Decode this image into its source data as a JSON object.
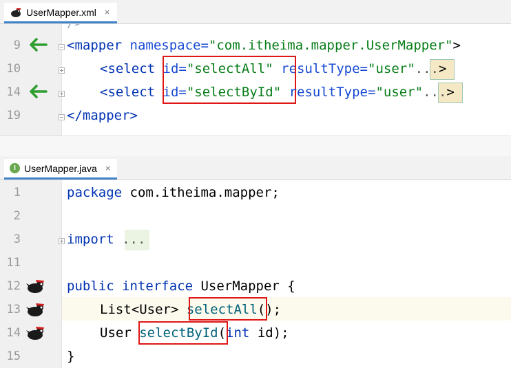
{
  "top_tab": {
    "label": "UserMapper.xml",
    "close": "×"
  },
  "bottom_tab": {
    "label": "UserMapper.java",
    "close": "×",
    "type_letter": "I"
  },
  "xml": {
    "line_numbers": [
      "9",
      "10",
      "14",
      "19"
    ],
    "mapper_open": "<mapper",
    "ns_attr": "namespace=",
    "ns_value": "\"com.itheima.mapper.UserMapper\"",
    "mapper_gt": ">",
    "select_open": "<select",
    "id1_attr": "id=",
    "id1_value": "\"selectAll\"",
    "rt_attr": "resultType=",
    "rt_value": "\"user\"",
    "folded": "...",
    "tag_end": ">",
    "id2_attr": "id=",
    "id2_value": "\"selectById\"",
    "mapper_close": "</mapper>",
    "partial_top": "/>"
  },
  "java": {
    "line_numbers": [
      "1",
      "2",
      "3",
      "11",
      "12",
      "13",
      "14",
      "15"
    ],
    "package_kw": "package",
    "package_name": " com.itheima.mapper;",
    "import_kw": "import",
    "import_folded": "...",
    "public_kw": "public",
    "interface_kw": "interface",
    "iface_name": " UserMapper {",
    "list_type": "List<User> ",
    "method1": "selectAll",
    "method1_rest": "();",
    "user_type": "User ",
    "method2": "selectById",
    "method2_paren": "(",
    "int_kw": "int",
    "method2_rest": " id);",
    "close_brace": "}"
  },
  "colors": {
    "keyword": "#0033b3",
    "string": "#067d17",
    "method": "#00627a",
    "highlight_box": "#e01616",
    "arrow": "#2e9e2e"
  }
}
